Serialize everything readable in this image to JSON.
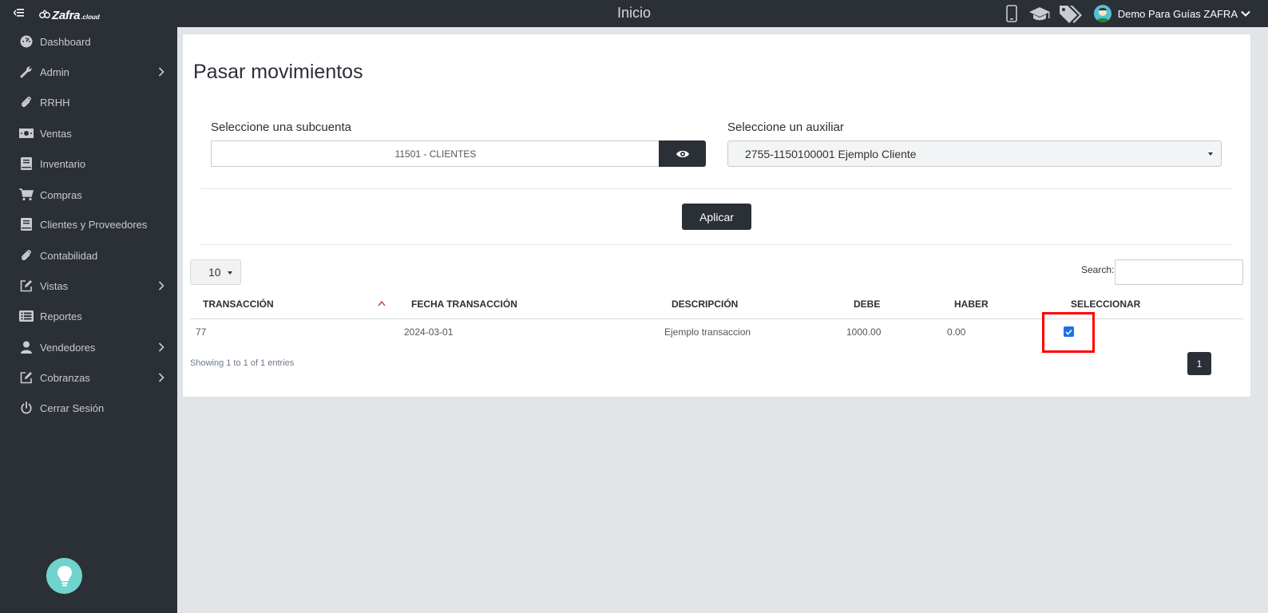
{
  "header": {
    "title": "Inicio",
    "logo": {
      "name": "Zafra",
      "suffix": ".cloud"
    },
    "icons": [
      "mobile-icon",
      "graduation-cap-icon",
      "tags-icon"
    ],
    "user_name": "Demo Para Guías ZAFRA"
  },
  "sidebar": {
    "items": [
      {
        "label": "Dashboard",
        "icon": "dashboard-icon",
        "has_submenu": false
      },
      {
        "label": "Admin",
        "icon": "wrench-icon",
        "has_submenu": true
      },
      {
        "label": "RRHH",
        "icon": "paperclip-icon",
        "has_submenu": false
      },
      {
        "label": "Ventas",
        "icon": "money-icon",
        "has_submenu": false
      },
      {
        "label": "Inventario",
        "icon": "book-icon",
        "has_submenu": false
      },
      {
        "label": "Compras",
        "icon": "cart-icon",
        "has_submenu": false
      },
      {
        "label": "Clientes y Proveedores",
        "icon": "book-icon",
        "has_submenu": false
      },
      {
        "label": "Contabilidad",
        "icon": "paperclip-icon",
        "has_submenu": false
      },
      {
        "label": "Vistas",
        "icon": "edit-icon",
        "has_submenu": true
      },
      {
        "label": "Reportes",
        "icon": "list-icon",
        "has_submenu": false
      },
      {
        "label": "Vendedores",
        "icon": "user-icon",
        "has_submenu": true
      },
      {
        "label": "Cobranzas",
        "icon": "edit-icon",
        "has_submenu": true
      },
      {
        "label": "Cerrar Sesión",
        "icon": "power-icon",
        "has_submenu": false
      }
    ]
  },
  "main": {
    "title": "Pasar movimientos",
    "subcuenta": {
      "label": "Seleccione una subcuenta",
      "value": "11501 - CLIENTES"
    },
    "auxiliar": {
      "label": "Seleccione un auxiliar",
      "value": "2755-1150100001 Ejemplo Cliente"
    },
    "apply_label": "Aplicar",
    "page_length": "10",
    "search_label": "Search:",
    "search_value": "",
    "table": {
      "columns": [
        "TRANSACCIÓN",
        "FECHA TRANSACCIÓN",
        "DESCRIPCIÓN",
        "DEBE",
        "HABER",
        "SELECCIONAR"
      ],
      "rows": [
        {
          "transaccion": "77",
          "fecha": "2024-03-01",
          "descripcion": "Ejemplo transaccion",
          "debe": "1000.00",
          "haber": "0.00",
          "seleccionar": true
        }
      ]
    },
    "info": "Showing 1 to 1 of 1 entries",
    "pages": [
      "1"
    ]
  },
  "colors": {
    "dark": "#2b2f36",
    "highlight": "#ff0000",
    "checkbox": "#1a73e8",
    "bulb": "#6fd4ce",
    "sort_arrow": "#c0392b"
  }
}
